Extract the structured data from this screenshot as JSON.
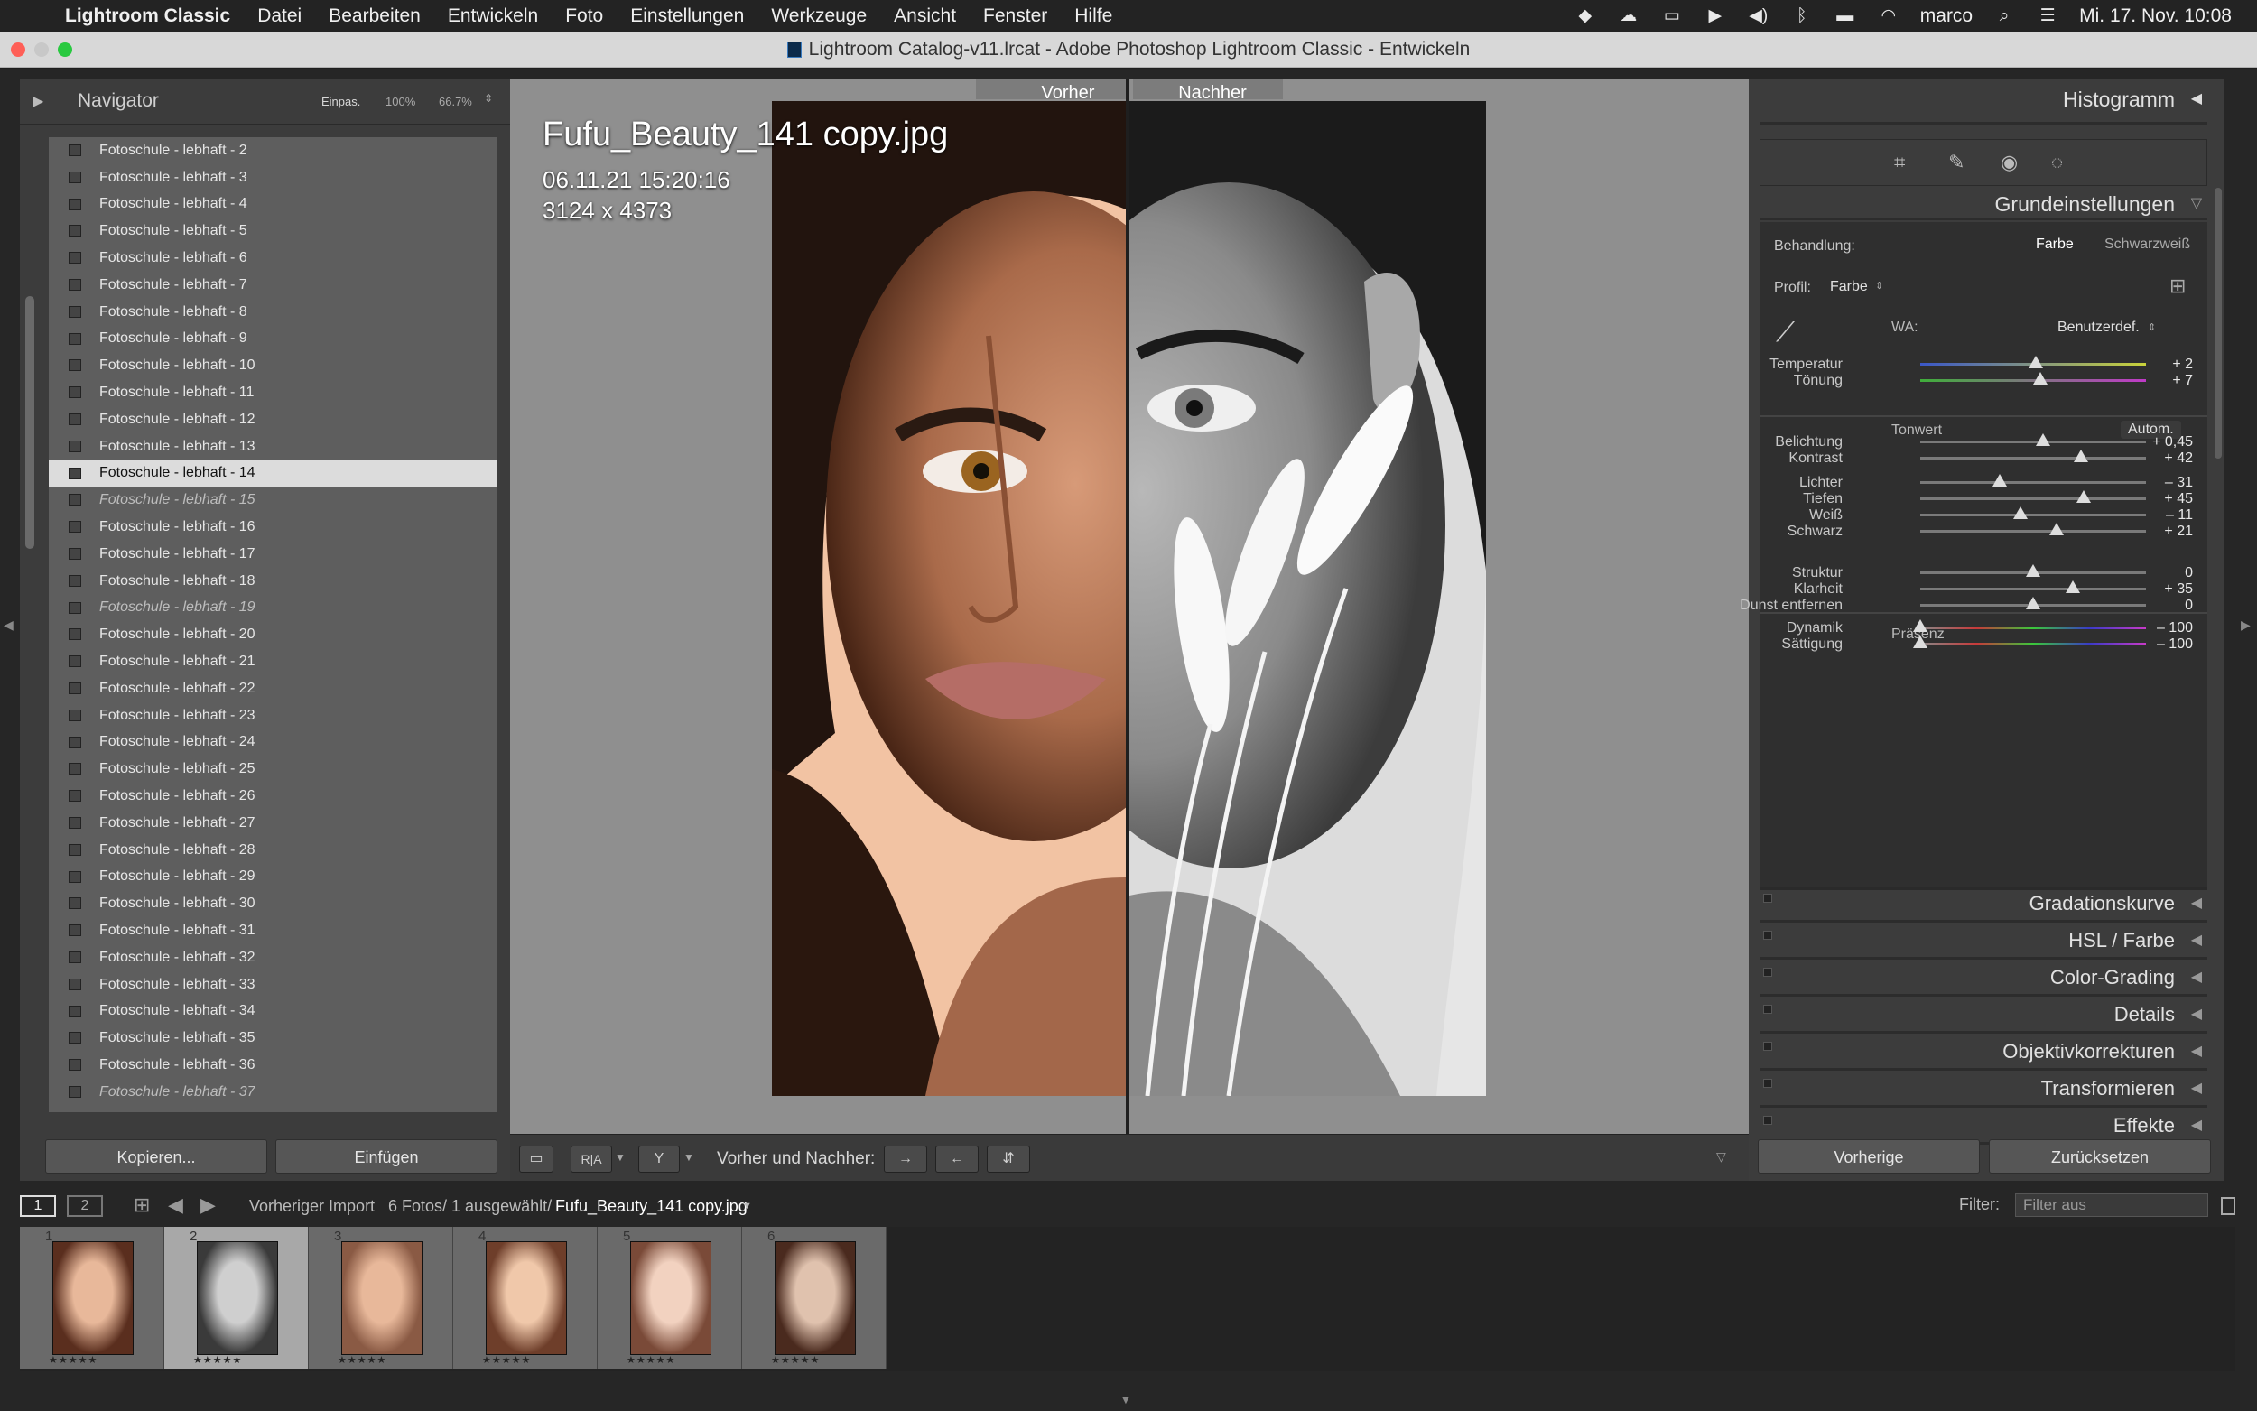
{
  "menubar": {
    "app_name": "Lightroom Classic",
    "items": [
      "Datei",
      "Bearbeiten",
      "Entwickeln",
      "Foto",
      "Einstellungen",
      "Werkzeuge",
      "Ansicht",
      "Fenster",
      "Hilfe"
    ],
    "user": "marco",
    "datetime": "Mi. 17. Nov.  10:08"
  },
  "window": {
    "title": "Lightroom Catalog-v11.lrcat - Adobe Photoshop Lightroom Classic - Entwickeln"
  },
  "navigator": {
    "title": "Navigator",
    "zoom_fit": "Einpas.",
    "zoom_100": "100%",
    "zoom_667": "66.7%"
  },
  "presets": [
    {
      "label": "Fotoschule - lebhaft - 2",
      "style": "normal"
    },
    {
      "label": "Fotoschule - lebhaft - 3",
      "style": "normal"
    },
    {
      "label": "Fotoschule - lebhaft - 4",
      "style": "normal"
    },
    {
      "label": "Fotoschule - lebhaft - 5",
      "style": "normal"
    },
    {
      "label": "Fotoschule - lebhaft - 6",
      "style": "normal"
    },
    {
      "label": "Fotoschule - lebhaft - 7",
      "style": "normal"
    },
    {
      "label": "Fotoschule - lebhaft - 8",
      "style": "normal"
    },
    {
      "label": "Fotoschule - lebhaft - 9",
      "style": "normal"
    },
    {
      "label": "Fotoschule - lebhaft - 10",
      "style": "normal"
    },
    {
      "label": "Fotoschule - lebhaft - 11",
      "style": "normal"
    },
    {
      "label": "Fotoschule - lebhaft - 12",
      "style": "normal"
    },
    {
      "label": "Fotoschule - lebhaft - 13",
      "style": "normal"
    },
    {
      "label": "Fotoschule - lebhaft - 14",
      "style": "selected"
    },
    {
      "label": "Fotoschule - lebhaft - 15",
      "style": "italic"
    },
    {
      "label": "Fotoschule - lebhaft - 16",
      "style": "normal"
    },
    {
      "label": "Fotoschule - lebhaft - 17",
      "style": "normal"
    },
    {
      "label": "Fotoschule - lebhaft - 18",
      "style": "normal"
    },
    {
      "label": "Fotoschule - lebhaft - 19",
      "style": "italic"
    },
    {
      "label": "Fotoschule - lebhaft - 20",
      "style": "normal"
    },
    {
      "label": "Fotoschule - lebhaft - 21",
      "style": "normal"
    },
    {
      "label": "Fotoschule - lebhaft - 22",
      "style": "normal"
    },
    {
      "label": "Fotoschule - lebhaft - 23",
      "style": "normal"
    },
    {
      "label": "Fotoschule - lebhaft - 24",
      "style": "normal"
    },
    {
      "label": "Fotoschule - lebhaft - 25",
      "style": "normal"
    },
    {
      "label": "Fotoschule - lebhaft - 26",
      "style": "normal"
    },
    {
      "label": "Fotoschule - lebhaft - 27",
      "style": "normal"
    },
    {
      "label": "Fotoschule - lebhaft - 28",
      "style": "normal"
    },
    {
      "label": "Fotoschule - lebhaft - 29",
      "style": "normal"
    },
    {
      "label": "Fotoschule - lebhaft - 30",
      "style": "normal"
    },
    {
      "label": "Fotoschule - lebhaft - 31",
      "style": "normal"
    },
    {
      "label": "Fotoschule - lebhaft - 32",
      "style": "normal"
    },
    {
      "label": "Fotoschule - lebhaft - 33",
      "style": "normal"
    },
    {
      "label": "Fotoschule - lebhaft - 34",
      "style": "normal"
    },
    {
      "label": "Fotoschule - lebhaft - 35",
      "style": "normal"
    },
    {
      "label": "Fotoschule - lebhaft - 36",
      "style": "normal"
    },
    {
      "label": "Fotoschule - lebhaft - 37",
      "style": "italic"
    }
  ],
  "left_buttons": {
    "copy": "Kopieren...",
    "paste": "Einfügen"
  },
  "photo": {
    "filename": "Fufu_Beauty_141 copy.jpg",
    "datetime": "06.11.21 15:20:16",
    "dimensions": "3124 x 4373",
    "before_label": "Vorher",
    "after_label": "Nachher"
  },
  "toolbar": {
    "before_after_label": "Vorher und Nachher:",
    "ra_label": "R|A"
  },
  "right_panel": {
    "histogram_title": "Histogramm",
    "basic_title": "Grundeinstellungen",
    "treatment_label": "Behandlung:",
    "treatment_color": "Farbe",
    "treatment_bw": "Schwarzweiß",
    "profile_label": "Profil:",
    "profile_value": "Farbe",
    "wb_label": "WA:",
    "wb_value": "Benutzerdef.",
    "tone_label": "Tonwert",
    "auto_label": "Autom.",
    "presence_label": "Präsenz",
    "sections": [
      "Gradationskurve",
      "HSL / Farbe",
      "Color-Grading",
      "Details",
      "Objektivkorrekturen",
      "Transformieren",
      "Effekte"
    ],
    "prev_button": "Vorherige",
    "reset_button": "Zurücksetzen"
  },
  "sliders": [
    {
      "label": "Temperatur",
      "value": "+ 2",
      "level": 0.51,
      "track": "temp"
    },
    {
      "label": "Tönung",
      "value": "+ 7",
      "level": 0.53,
      "track": "tint"
    },
    {
      "label": "Belichtung",
      "value": "+ 0,45",
      "level": 0.545,
      "track": "plain"
    },
    {
      "label": "Kontrast",
      "value": "+ 42",
      "level": 0.71,
      "track": "plain"
    },
    {
      "label": "Lichter",
      "value": "– 31",
      "level": 0.35,
      "track": "plain"
    },
    {
      "label": "Tiefen",
      "value": "+ 45",
      "level": 0.725,
      "track": "plain"
    },
    {
      "label": "Weiß",
      "value": "– 11",
      "level": 0.445,
      "track": "plain"
    },
    {
      "label": "Schwarz",
      "value": "+ 21",
      "level": 0.605,
      "track": "plain"
    },
    {
      "label": "Struktur",
      "value": "0",
      "level": 0.5,
      "track": "plain"
    },
    {
      "label": "Klarheit",
      "value": "+ 35",
      "level": 0.675,
      "track": "plain"
    },
    {
      "label": "Dunst entfernen",
      "value": "0",
      "level": 0.5,
      "track": "plain"
    },
    {
      "label": "Dynamik",
      "value": "– 100",
      "level": 0.0,
      "track": "vib"
    },
    {
      "label": "Sättigung",
      "value": "– 100",
      "level": 0.0,
      "track": "sat"
    }
  ],
  "filmbar": {
    "page1": "1",
    "page2": "2",
    "source": "Vorheriger Import",
    "count": "6 Fotos/  1 ausgewählt/",
    "current_file": "Fufu_Beauty_141 copy.jpg",
    "filter_label": "Filter:",
    "filter_value": "Filter aus"
  },
  "thumbnails": [
    {
      "num": "1",
      "stars": "★★★★★"
    },
    {
      "num": "2",
      "stars": "★★★★★"
    },
    {
      "num": "3",
      "stars": "★★★★★"
    },
    {
      "num": "4",
      "stars": "★★★★★"
    },
    {
      "num": "5",
      "stars": "★★★★★"
    },
    {
      "num": "6",
      "stars": "★★★★★"
    }
  ]
}
